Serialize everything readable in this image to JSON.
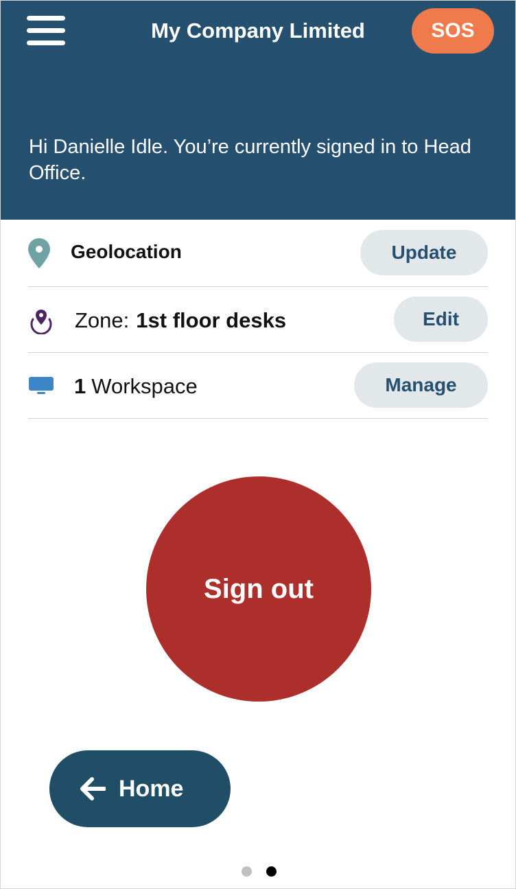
{
  "header": {
    "title": "My Company Limited",
    "sos_label": "SOS",
    "greeting": "Hi Danielle Idle. You’re currently signed in to Head Office.",
    "background_color": "#25506f"
  },
  "rows": {
    "geolocation": {
      "icon": "map-pin-icon",
      "label": "Geolocation",
      "action_label": "Update"
    },
    "zone": {
      "icon": "zone-location-icon",
      "prefix": "Zone:",
      "value": "1st floor desks",
      "action_label": "Edit"
    },
    "workspace": {
      "icon": "monitor-icon",
      "count": "1",
      "label": "Workspace",
      "action_label": "Manage"
    }
  },
  "sign_out": {
    "label": "Sign out",
    "color": "#ad2f2b"
  },
  "home": {
    "icon": "arrow-left-icon",
    "label": "Home",
    "color": "#1f4e66"
  },
  "pager": {
    "pages": 2,
    "active_page": 2
  },
  "colors": {
    "sos": "#ef7a4c",
    "pill_bg": "#e2e7ea",
    "pill_text": "#25506f",
    "geo_pin": "#6fa3a3",
    "zone_icon": "#4a2560",
    "monitor": "#3c86c8"
  }
}
